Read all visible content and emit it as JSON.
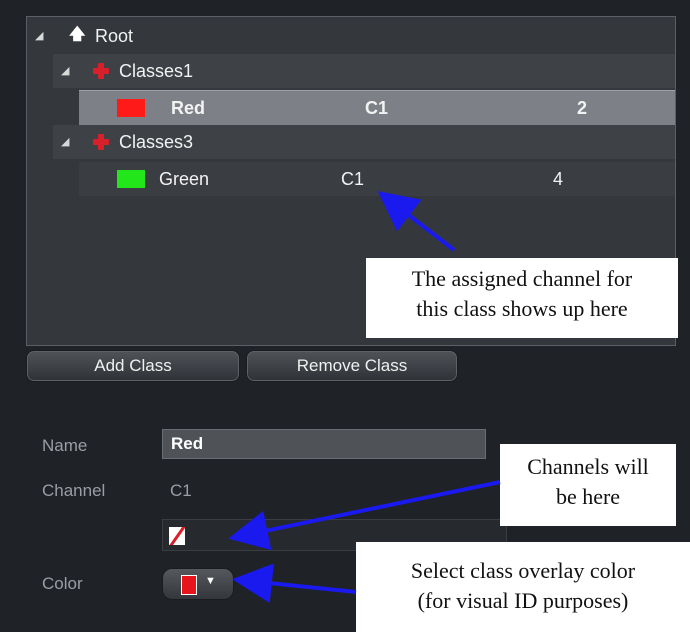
{
  "tree": {
    "root": {
      "label": "Root"
    },
    "groups": [
      {
        "label": "Classes1",
        "items": [
          {
            "name": "Red",
            "channel": "C1",
            "value": "2",
            "color": "#ff1a1a"
          }
        ]
      },
      {
        "label": "Classes3",
        "items": [
          {
            "name": "Green",
            "channel": "C1",
            "value": "4",
            "color": "#22e61a"
          }
        ]
      }
    ]
  },
  "buttons": {
    "add_class": "Add Class",
    "remove_class": "Remove Class"
  },
  "properties": {
    "name_label": "Name",
    "name_value": "Red",
    "channel_label": "Channel",
    "channel_value": "C1",
    "color_label": "Color",
    "overlay_color": "#e8141c"
  },
  "callouts": {
    "assigned_channel": [
      "The assigned channel for",
      "this class shows up here"
    ],
    "channels_here": [
      "Channels will",
      "be here"
    ],
    "select_color": [
      "Select class overlay color",
      "(for visual ID purposes)"
    ]
  },
  "colors": {
    "arrow": "#1a1aee",
    "panel_bg": "#1f2226",
    "selection": "#7d8187"
  },
  "icons": [
    "expand-triangle-icon",
    "up-arrow-icon",
    "red-cross-icon",
    "dropdown-caret-icon"
  ]
}
